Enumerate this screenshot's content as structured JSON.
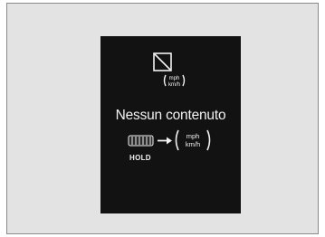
{
  "display": {
    "message": "Nessun contenuto",
    "hold_label": "HOLD",
    "unit_top": "mph",
    "unit_bottom": "km/h"
  },
  "icons": [
    "no-content-icon",
    "unit-toggle-icon",
    "thumbwheel-icon",
    "right-arrow-icon"
  ],
  "colors": {
    "background": "#e3e3e3",
    "screen": "#121212",
    "foreground": "#f2f2f2"
  }
}
